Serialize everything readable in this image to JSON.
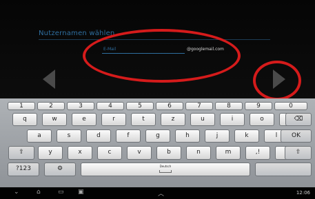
{
  "setup": {
    "title": "Nutzernamen wählen",
    "email_placeholder": "E-Mail",
    "domain": "@googlemail.com"
  },
  "keyboard": {
    "numbers": [
      "1",
      "2",
      "3",
      "4",
      "5",
      "6",
      "7",
      "8",
      "9",
      "0"
    ],
    "row1": [
      "q",
      "w",
      "e",
      "r",
      "t",
      "z",
      "u",
      "i",
      "o",
      "p"
    ],
    "row2": [
      "a",
      "s",
      "d",
      "f",
      "g",
      "h",
      "j",
      "k",
      "l"
    ],
    "row3": [
      "y",
      "x",
      "c",
      "v",
      "b",
      "n",
      "m",
      ",!",
      ".?"
    ],
    "backspace": "⌫",
    "ok": "OK",
    "shift": "⇧",
    "symbols": "?123",
    "settings": "⚙",
    "space_label": "Deutsch"
  },
  "navbar": {
    "back": "⌄",
    "home": "⌂",
    "recent": "▭",
    "screenshot": "▣",
    "up": "︿",
    "time": "12:06"
  },
  "colors": {
    "accent": "#2f6fa0",
    "annotation": "#d51b1b",
    "background": "#070707",
    "keyboard": "#a5a9ad"
  }
}
